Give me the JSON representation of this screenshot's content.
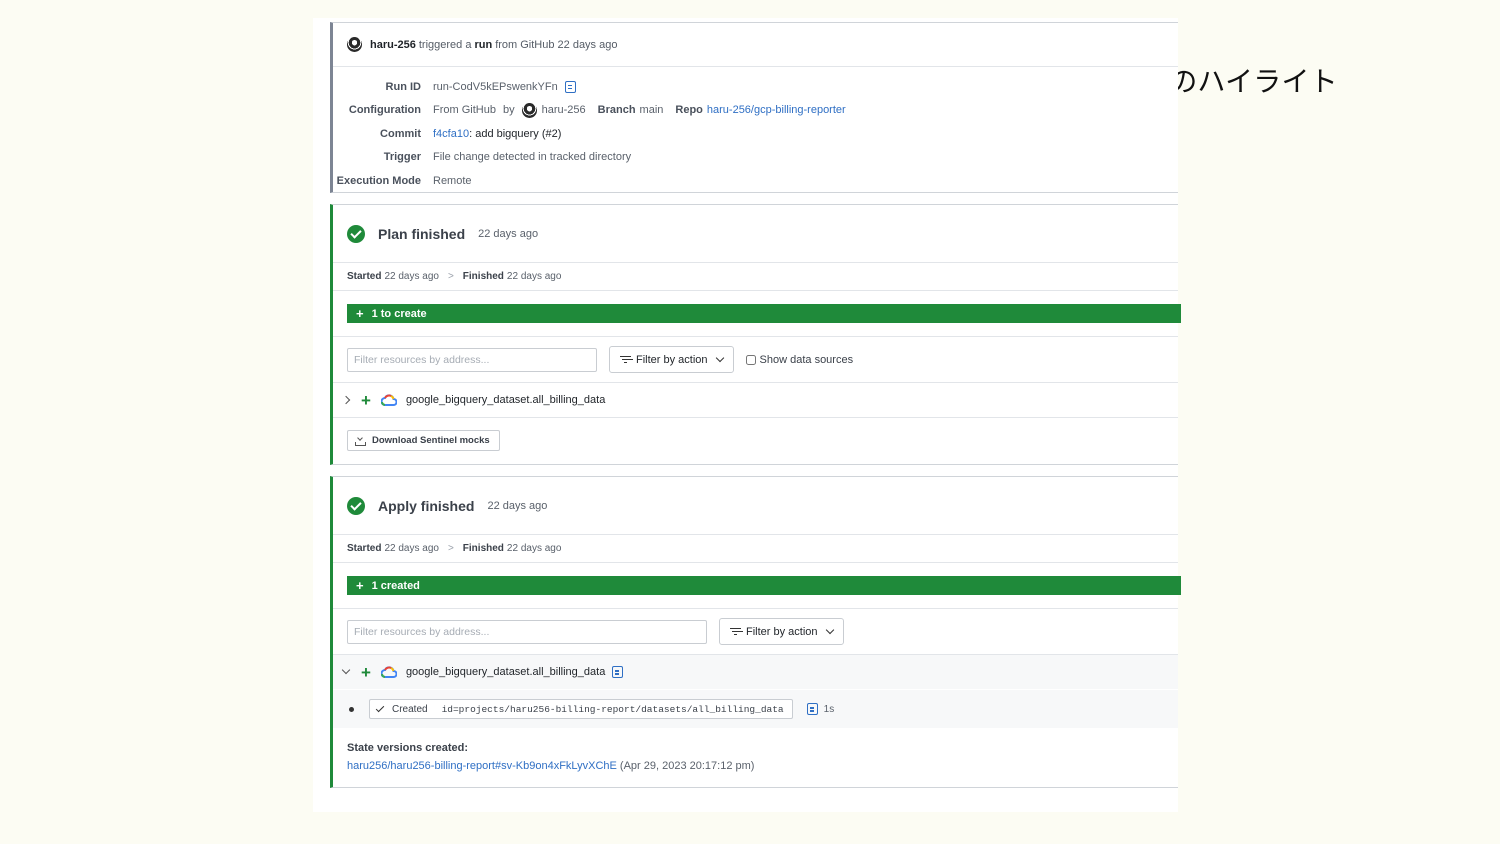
{
  "annotation": "terraform apply のハイライト",
  "run_header": {
    "user": "haru-256",
    "triggered_text": "triggered a",
    "run_word": "run",
    "source_text": "from GitHub 22 days ago"
  },
  "details": {
    "run_id_label": "Run ID",
    "run_id": "run-CodV5kEPswenkYFn",
    "configuration_label": "Configuration",
    "configuration_from": "From GitHub",
    "configuration_by": "by",
    "configuration_user": "haru-256",
    "branch_label": "Branch",
    "branch": "main",
    "repo_label": "Repo",
    "repo": "haru-256/gcp-billing-reporter",
    "commit_label": "Commit",
    "commit_hash": "f4cfa10",
    "commit_message": ": add bigquery (#2)",
    "trigger_label": "Trigger",
    "trigger": "File change detected in tracked directory",
    "execution_mode_label": "Execution Mode",
    "execution_mode": "Remote"
  },
  "plan": {
    "title": "Plan finished",
    "time": "22 days ago",
    "started_label": "Started",
    "started": "22 days ago",
    "separator": ">",
    "finished_label": "Finished",
    "finished": "22 days ago",
    "summary_icon": "+",
    "summary": "1 to create",
    "filter_placeholder": "Filter resources by address...",
    "filter_button": "Filter by action",
    "show_data_sources": "Show data sources",
    "resource_icon": "+",
    "resource": "google_bigquery_dataset.all_billing_data",
    "download_button": "Download Sentinel mocks"
  },
  "apply": {
    "title": "Apply finished",
    "time": "22 days ago",
    "started_label": "Started",
    "started": "22 days ago",
    "separator": ">",
    "finished_label": "Finished",
    "finished": "22 days ago",
    "summary_icon": "+",
    "summary": "1 created",
    "filter_placeholder": "Filter resources by address...",
    "filter_button": "Filter by action",
    "resource_icon": "+",
    "resource": "google_bigquery_dataset.all_billing_data",
    "created_label": "Created",
    "created_id": "id=projects/haru256-billing-report/datasets/all_billing_data",
    "duration": "1s",
    "state_title": "State versions created:",
    "state_link": "haru256/haru256-billing-report#sv-Kb9on4xFkLyvXChE",
    "state_time": "(Apr 29, 2023 20:17:12 pm)"
  },
  "colors": {
    "accent_green": "#1f8a3a",
    "link_blue": "#2f6fc4",
    "grey_border": "#7d8594"
  },
  "icons": {
    "check": "check-circle-icon",
    "copy": "clipboard-icon",
    "filter": "filter-icon",
    "gcp": "google-cloud-icon",
    "download": "download-icon"
  }
}
